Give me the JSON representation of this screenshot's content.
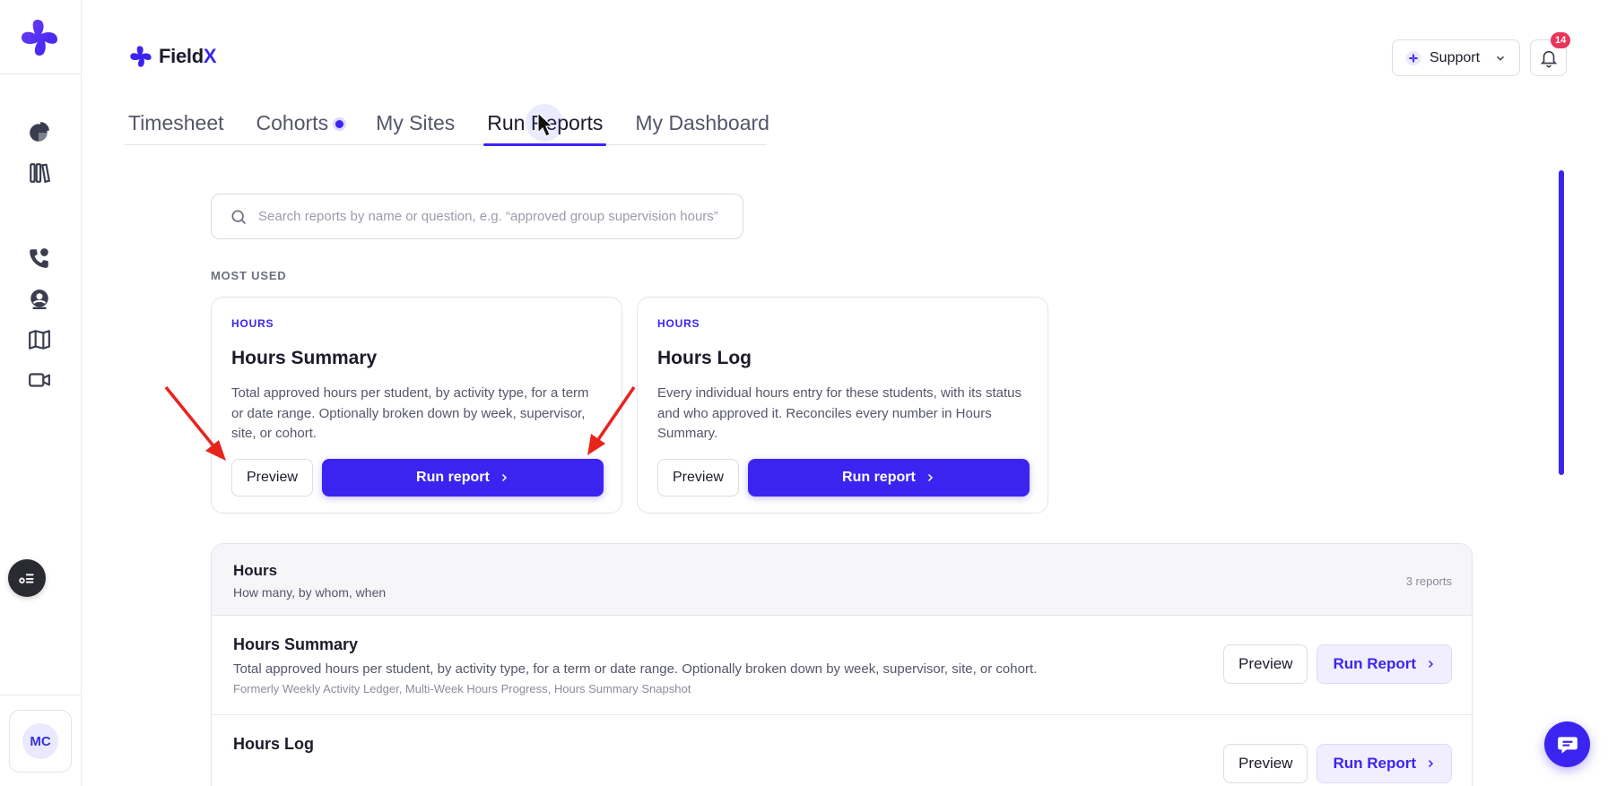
{
  "colors": {
    "accent": "#3c24f0",
    "badge": "#e8355a",
    "annotation_arrow": "#e8231c"
  },
  "rail": {
    "icons": [
      "pie-chart-icon",
      "library-icon",
      "phone-icon",
      "user-location-icon",
      "map-icon",
      "video-icon"
    ],
    "avatar_initials": "MC"
  },
  "header": {
    "logo_text_main": "Field",
    "logo_text_accent": "X",
    "support_label": "Support",
    "notification_count": "14"
  },
  "tabs": [
    {
      "label": "Timesheet",
      "active": false
    },
    {
      "label": "Cohorts",
      "active": false,
      "has_dot": true
    },
    {
      "label": "My Sites",
      "active": false
    },
    {
      "label": "Run Reports",
      "active": true
    },
    {
      "label": "My Dashboard",
      "active": false
    }
  ],
  "search": {
    "placeholder": "Search reports by name or question, e.g. “approved group supervision hours”",
    "value": ""
  },
  "most_used": {
    "label": "MOST USED",
    "cards": [
      {
        "tag": "HOURS",
        "title": "Hours Summary",
        "description": "Total approved hours per student, by activity type, for a term or date range. Optionally broken down by week, supervisor, site, or cohort.",
        "preview_label": "Preview",
        "run_label": "Run report"
      },
      {
        "tag": "HOURS",
        "title": "Hours Log",
        "description": "Every individual hours entry for these students, with its status and who approved it. Reconciles every number in Hours Summary.",
        "preview_label": "Preview",
        "run_label": "Run report"
      }
    ]
  },
  "report_group": {
    "title": "Hours",
    "subtitle": "How many, by whom, when",
    "count": "3 reports",
    "rows": [
      {
        "title": "Hours Summary",
        "description": "Total approved hours per student, by activity type, for a term or date range. Optionally broken down by week, supervisor, site, or cohort.",
        "formerly": "Formerly Weekly Activity Ledger, Multi-Week Hours Progress, Hours Summary Snapshot",
        "preview_label": "Preview",
        "run_label": "Run Report"
      },
      {
        "title": "Hours Log",
        "description": "",
        "formerly": "",
        "preview_label": "Preview",
        "run_label": "Run Report"
      }
    ]
  }
}
